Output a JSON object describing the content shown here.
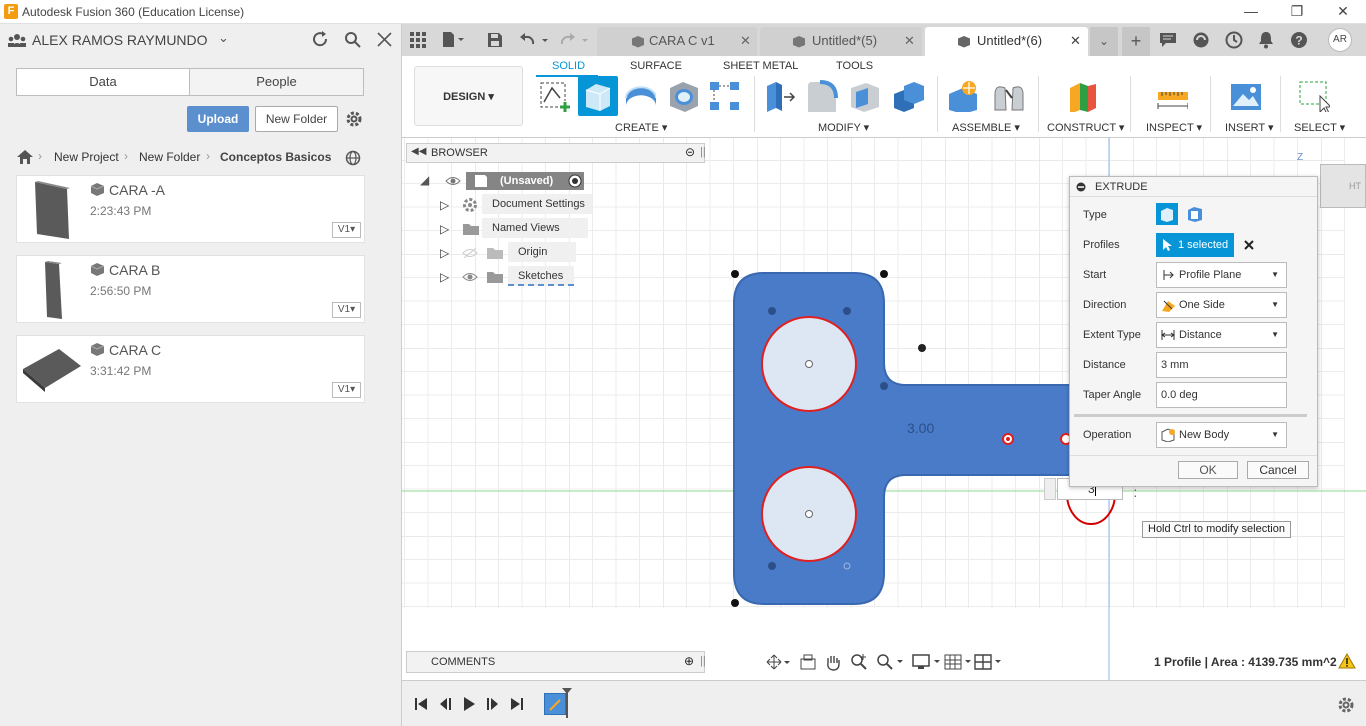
{
  "window": {
    "title": "Autodesk Fusion 360 (Education License)",
    "app_icon": "F"
  },
  "left_panel": {
    "user_name": "ALEX RAMOS RAYMUNDO",
    "tabs": [
      "Data",
      "People"
    ],
    "upload_label": "Upload",
    "new_folder_label": "New Folder",
    "breadcrumb": [
      "New Project",
      "New Folder",
      "Conceptos Basicos"
    ],
    "files": [
      {
        "name": "CARA -A",
        "time": "2:23:43 PM",
        "version": "V1"
      },
      {
        "name": "CARA B",
        "time": "2:56:50 PM",
        "version": "V1"
      },
      {
        "name": "CARA C",
        "time": "3:31:42 PM",
        "version": "V1"
      }
    ]
  },
  "doc_tabs": [
    {
      "label": "CARA C v1",
      "active": false
    },
    {
      "label": "Untitled*(5)",
      "active": false
    },
    {
      "label": "Untitled*(6)",
      "active": true
    }
  ],
  "user_initials": "AR",
  "ribbon": {
    "workspace": "DESIGN",
    "tabs": [
      "SOLID",
      "SURFACE",
      "SHEET METAL",
      "TOOLS"
    ],
    "active_tab": "SOLID",
    "groups": [
      "CREATE",
      "MODIFY",
      "ASSEMBLE",
      "CONSTRUCT",
      "INSPECT",
      "INSERT",
      "SELECT"
    ]
  },
  "browser": {
    "title": "BROWSER",
    "root": "(Unsaved)",
    "items": [
      "Document Settings",
      "Named Views",
      "Origin",
      "Sketches"
    ]
  },
  "comments_label": "COMMENTS",
  "viewcube_label": "HT",
  "viewcube_axis": "Z",
  "extrude": {
    "title": "EXTRUDE",
    "rows": [
      {
        "label": "Type",
        "value": ""
      },
      {
        "label": "Profiles",
        "value": "1 selected"
      },
      {
        "label": "Start",
        "value": "Profile Plane"
      },
      {
        "label": "Direction",
        "value": "One Side"
      },
      {
        "label": "Extent Type",
        "value": "Distance"
      },
      {
        "label": "Distance",
        "value": "3 mm"
      },
      {
        "label": "Taper Angle",
        "value": "0.0 deg"
      },
      {
        "label": "Operation",
        "value": "New Body"
      }
    ],
    "ok_label": "OK",
    "cancel_label": "Cancel"
  },
  "canvas": {
    "dimension_label": "3.00",
    "input_value": "3",
    "tooltip": "Hold Ctrl to modify selection",
    "status": "1 Profile | Area : 4139.735 mm^2"
  },
  "colors": {
    "accent": "#0696d7",
    "body": "#4a7bc8",
    "hole_ring": "#e02020"
  }
}
